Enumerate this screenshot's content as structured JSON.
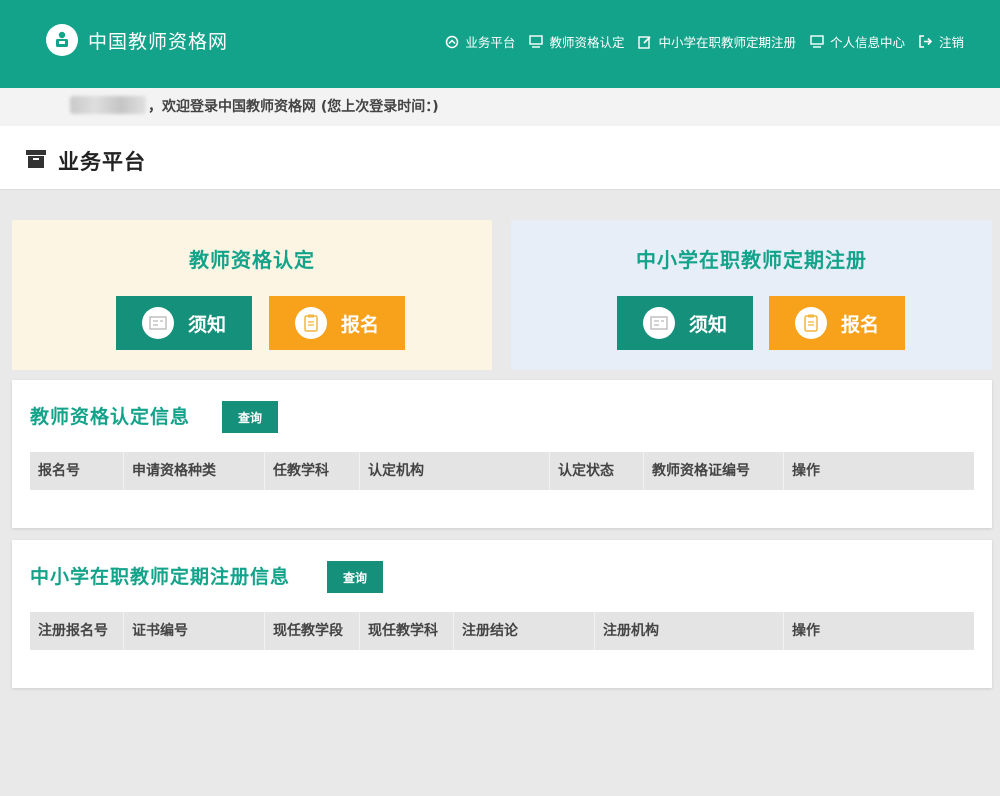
{
  "brand": {
    "name": "中国教师资格网"
  },
  "nav": [
    {
      "label": "业务平台",
      "icon": "platform-icon"
    },
    {
      "label": "教师资格认定",
      "icon": "monitor-icon"
    },
    {
      "label": "中小学在职教师定期注册",
      "icon": "edit-icon"
    },
    {
      "label": "个人信息中心",
      "icon": "monitor-icon"
    },
    {
      "label": "注销",
      "icon": "logout-icon"
    }
  ],
  "welcome": {
    "text": "，欢迎登录中国教师资格网 (您上次登录时间：)"
  },
  "page": {
    "title": "业务平台"
  },
  "cards": [
    {
      "title": "教师资格认定",
      "notice_label": "须知",
      "apply_label": "报名"
    },
    {
      "title": "中小学在职教师定期注册",
      "notice_label": "须知",
      "apply_label": "报名"
    }
  ],
  "panels": [
    {
      "title": "教师资格认定信息",
      "query_label": "查询",
      "columns": [
        "报名号",
        "申请资格种类",
        "任教学科",
        "认定机构",
        "认定状态",
        "教师资格证编号",
        "操作"
      ]
    },
    {
      "title": "中小学在职教师定期注册信息",
      "query_label": "查询",
      "columns": [
        "注册报名号",
        "证书编号",
        "现任教学段",
        "现任教学科",
        "注册结论",
        "注册机构",
        "操作"
      ]
    }
  ],
  "colors": {
    "primary": "#13a38a",
    "button_green": "#14907b",
    "button_orange": "#f7a21a"
  }
}
